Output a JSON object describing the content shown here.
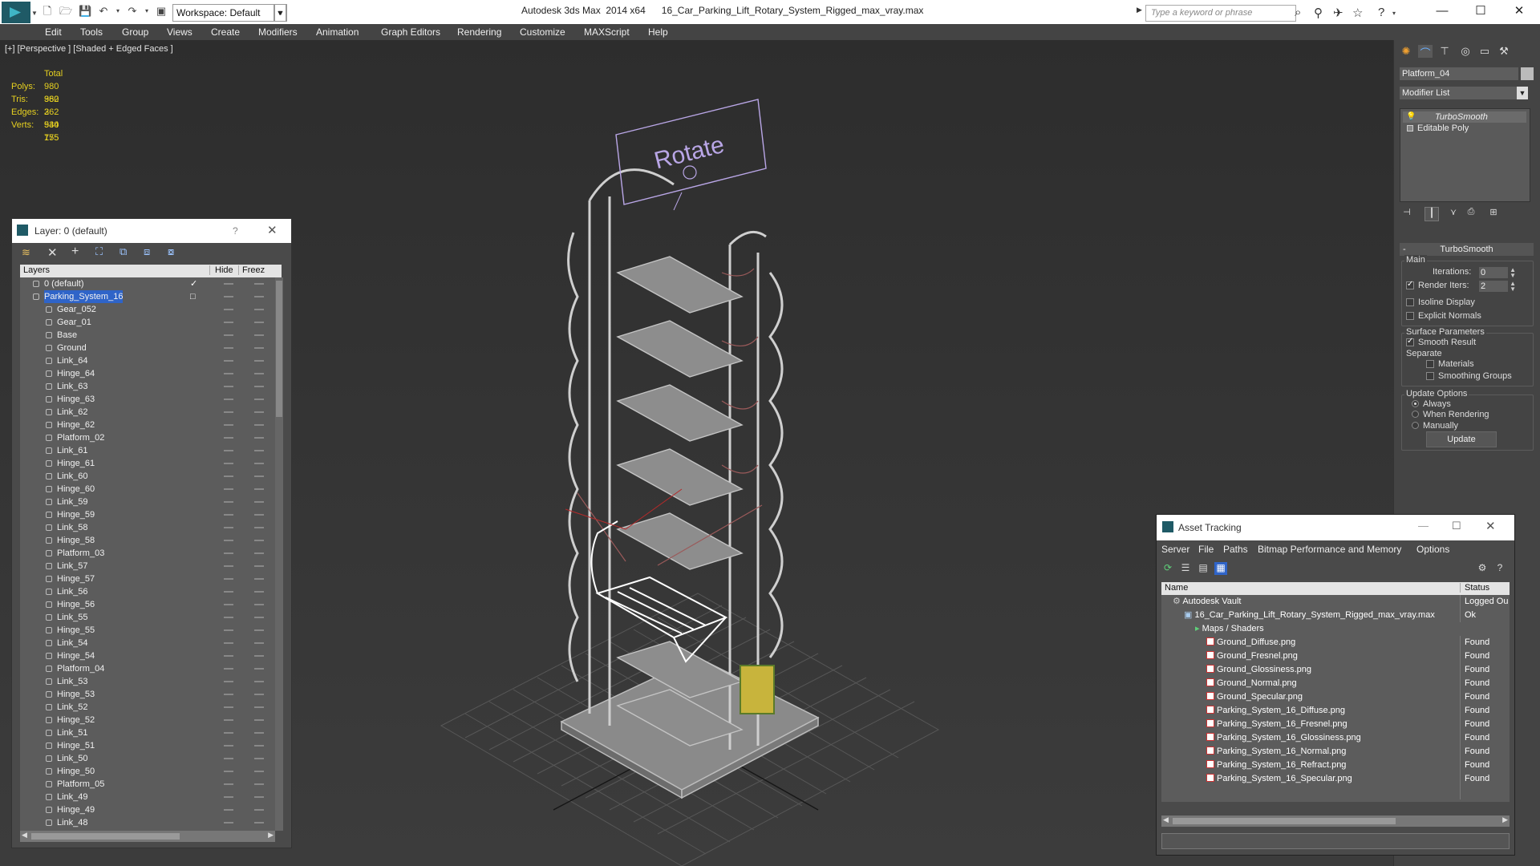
{
  "app": {
    "title": "Autodesk 3ds Max  2014 x64",
    "file": "16_Car_Parking_Lift_Rotary_System_Rigged_max_vray.max",
    "workspace": "Workspace: Default",
    "search_placeholder": "Type a keyword or phrase"
  },
  "menu": [
    "Edit",
    "Tools",
    "Group",
    "Views",
    "Create",
    "Modifiers",
    "Animation",
    "Graph Editors",
    "Rendering",
    "Customize",
    "MAXScript",
    "Help"
  ],
  "viewport": {
    "label": "[+] [Perspective ] [Shaded + Edged Faces ]",
    "sign_text": "Rotate",
    "stats": {
      "header": "Total",
      "rows": [
        {
          "label": "Polys:",
          "value": "980 362"
        },
        {
          "label": "Tris:",
          "value": "980 362"
        },
        {
          "label": "Edges:",
          "value": "2 940 155"
        },
        {
          "label": "Verts:",
          "value": "534 775"
        }
      ]
    }
  },
  "layer_panel": {
    "title": "Layer: 0 (default)",
    "help": "?",
    "columns": {
      "name": "Layers",
      "hide": "Hide",
      "freeze": "Freez"
    },
    "layers": [
      {
        "name": "0 (default)",
        "level": 0,
        "current": true
      },
      {
        "name": "Parking_System_16",
        "level": 0,
        "selected": true
      }
    ],
    "objects": [
      "Gear_052",
      "Gear_01",
      "Base",
      "Ground",
      "Link_64",
      "Hinge_64",
      "Link_63",
      "Hinge_63",
      "Link_62",
      "Hinge_62",
      "Platform_02",
      "Link_61",
      "Hinge_61",
      "Link_60",
      "Hinge_60",
      "Link_59",
      "Hinge_59",
      "Link_58",
      "Hinge_58",
      "Platform_03",
      "Link_57",
      "Hinge_57",
      "Link_56",
      "Hinge_56",
      "Link_55",
      "Hinge_55",
      "Link_54",
      "Hinge_54",
      "Platform_04",
      "Link_53",
      "Hinge_53",
      "Link_52",
      "Hinge_52",
      "Link_51",
      "Hinge_51",
      "Link_50",
      "Hinge_50",
      "Platform_05",
      "Link_49",
      "Hinge_49",
      "Link_48"
    ]
  },
  "command_panel": {
    "object_name": "Platform_04",
    "modifier_list": "Modifier List",
    "stack": [
      {
        "name": "TurboSmooth",
        "italic": true
      },
      {
        "name": "Editable Poly",
        "italic": false
      }
    ],
    "rollout": "TurboSmooth",
    "main": {
      "group": "Main",
      "iterations_label": "Iterations:",
      "iterations": "0",
      "render_iters_label": "Render Iters:",
      "render_iters": "2",
      "render_iters_on": true,
      "isoline": "Isoline Display",
      "isoline_on": false,
      "explicit": "Explicit Normals",
      "explicit_on": false
    },
    "surface": {
      "group": "Surface Parameters",
      "smooth_result": "Smooth Result",
      "smooth_result_on": true,
      "separate": "Separate",
      "materials": "Materials",
      "smoothing_groups": "Smoothing Groups"
    },
    "update": {
      "group": "Update Options",
      "options": [
        "Always",
        "When Rendering",
        "Manually"
      ],
      "selected": 0,
      "button": "Update"
    }
  },
  "asset_tracking": {
    "title": "Asset Tracking",
    "menu": [
      "Server",
      "File",
      "Paths",
      "Bitmap Performance and Memory",
      "Options"
    ],
    "columns": {
      "name": "Name",
      "status": "Status"
    },
    "rows": [
      {
        "name": "Autodesk Vault",
        "status": "Logged Ou",
        "level": 0,
        "kind": "vault"
      },
      {
        "name": "16_Car_Parking_Lift_Rotary_System_Rigged_max_vray.max",
        "status": "Ok",
        "level": 1,
        "kind": "max"
      },
      {
        "name": "Maps / Shaders",
        "status": "",
        "level": 2,
        "kind": "folder"
      },
      {
        "name": "Ground_Diffuse.png",
        "status": "Found",
        "level": 3,
        "kind": "png"
      },
      {
        "name": "Ground_Fresnel.png",
        "status": "Found",
        "level": 3,
        "kind": "png"
      },
      {
        "name": "Ground_Glossiness.png",
        "status": "Found",
        "level": 3,
        "kind": "png"
      },
      {
        "name": "Ground_Normal.png",
        "status": "Found",
        "level": 3,
        "kind": "png"
      },
      {
        "name": "Ground_Specular.png",
        "status": "Found",
        "level": 3,
        "kind": "png"
      },
      {
        "name": "Parking_System_16_Diffuse.png",
        "status": "Found",
        "level": 3,
        "kind": "png"
      },
      {
        "name": "Parking_System_16_Fresnel.png",
        "status": "Found",
        "level": 3,
        "kind": "png"
      },
      {
        "name": "Parking_System_16_Glossiness.png",
        "status": "Found",
        "level": 3,
        "kind": "png"
      },
      {
        "name": "Parking_System_16_Normal.png",
        "status": "Found",
        "level": 3,
        "kind": "png"
      },
      {
        "name": "Parking_System_16_Refract.png",
        "status": "Found",
        "level": 3,
        "kind": "png"
      },
      {
        "name": "Parking_System_16_Specular.png",
        "status": "Found",
        "level": 3,
        "kind": "png"
      }
    ]
  },
  "colors": {
    "selection": "#2f64c8",
    "stats": "#e6d020",
    "sign": "#b9a6e6",
    "selected_object": "#ffffff"
  }
}
